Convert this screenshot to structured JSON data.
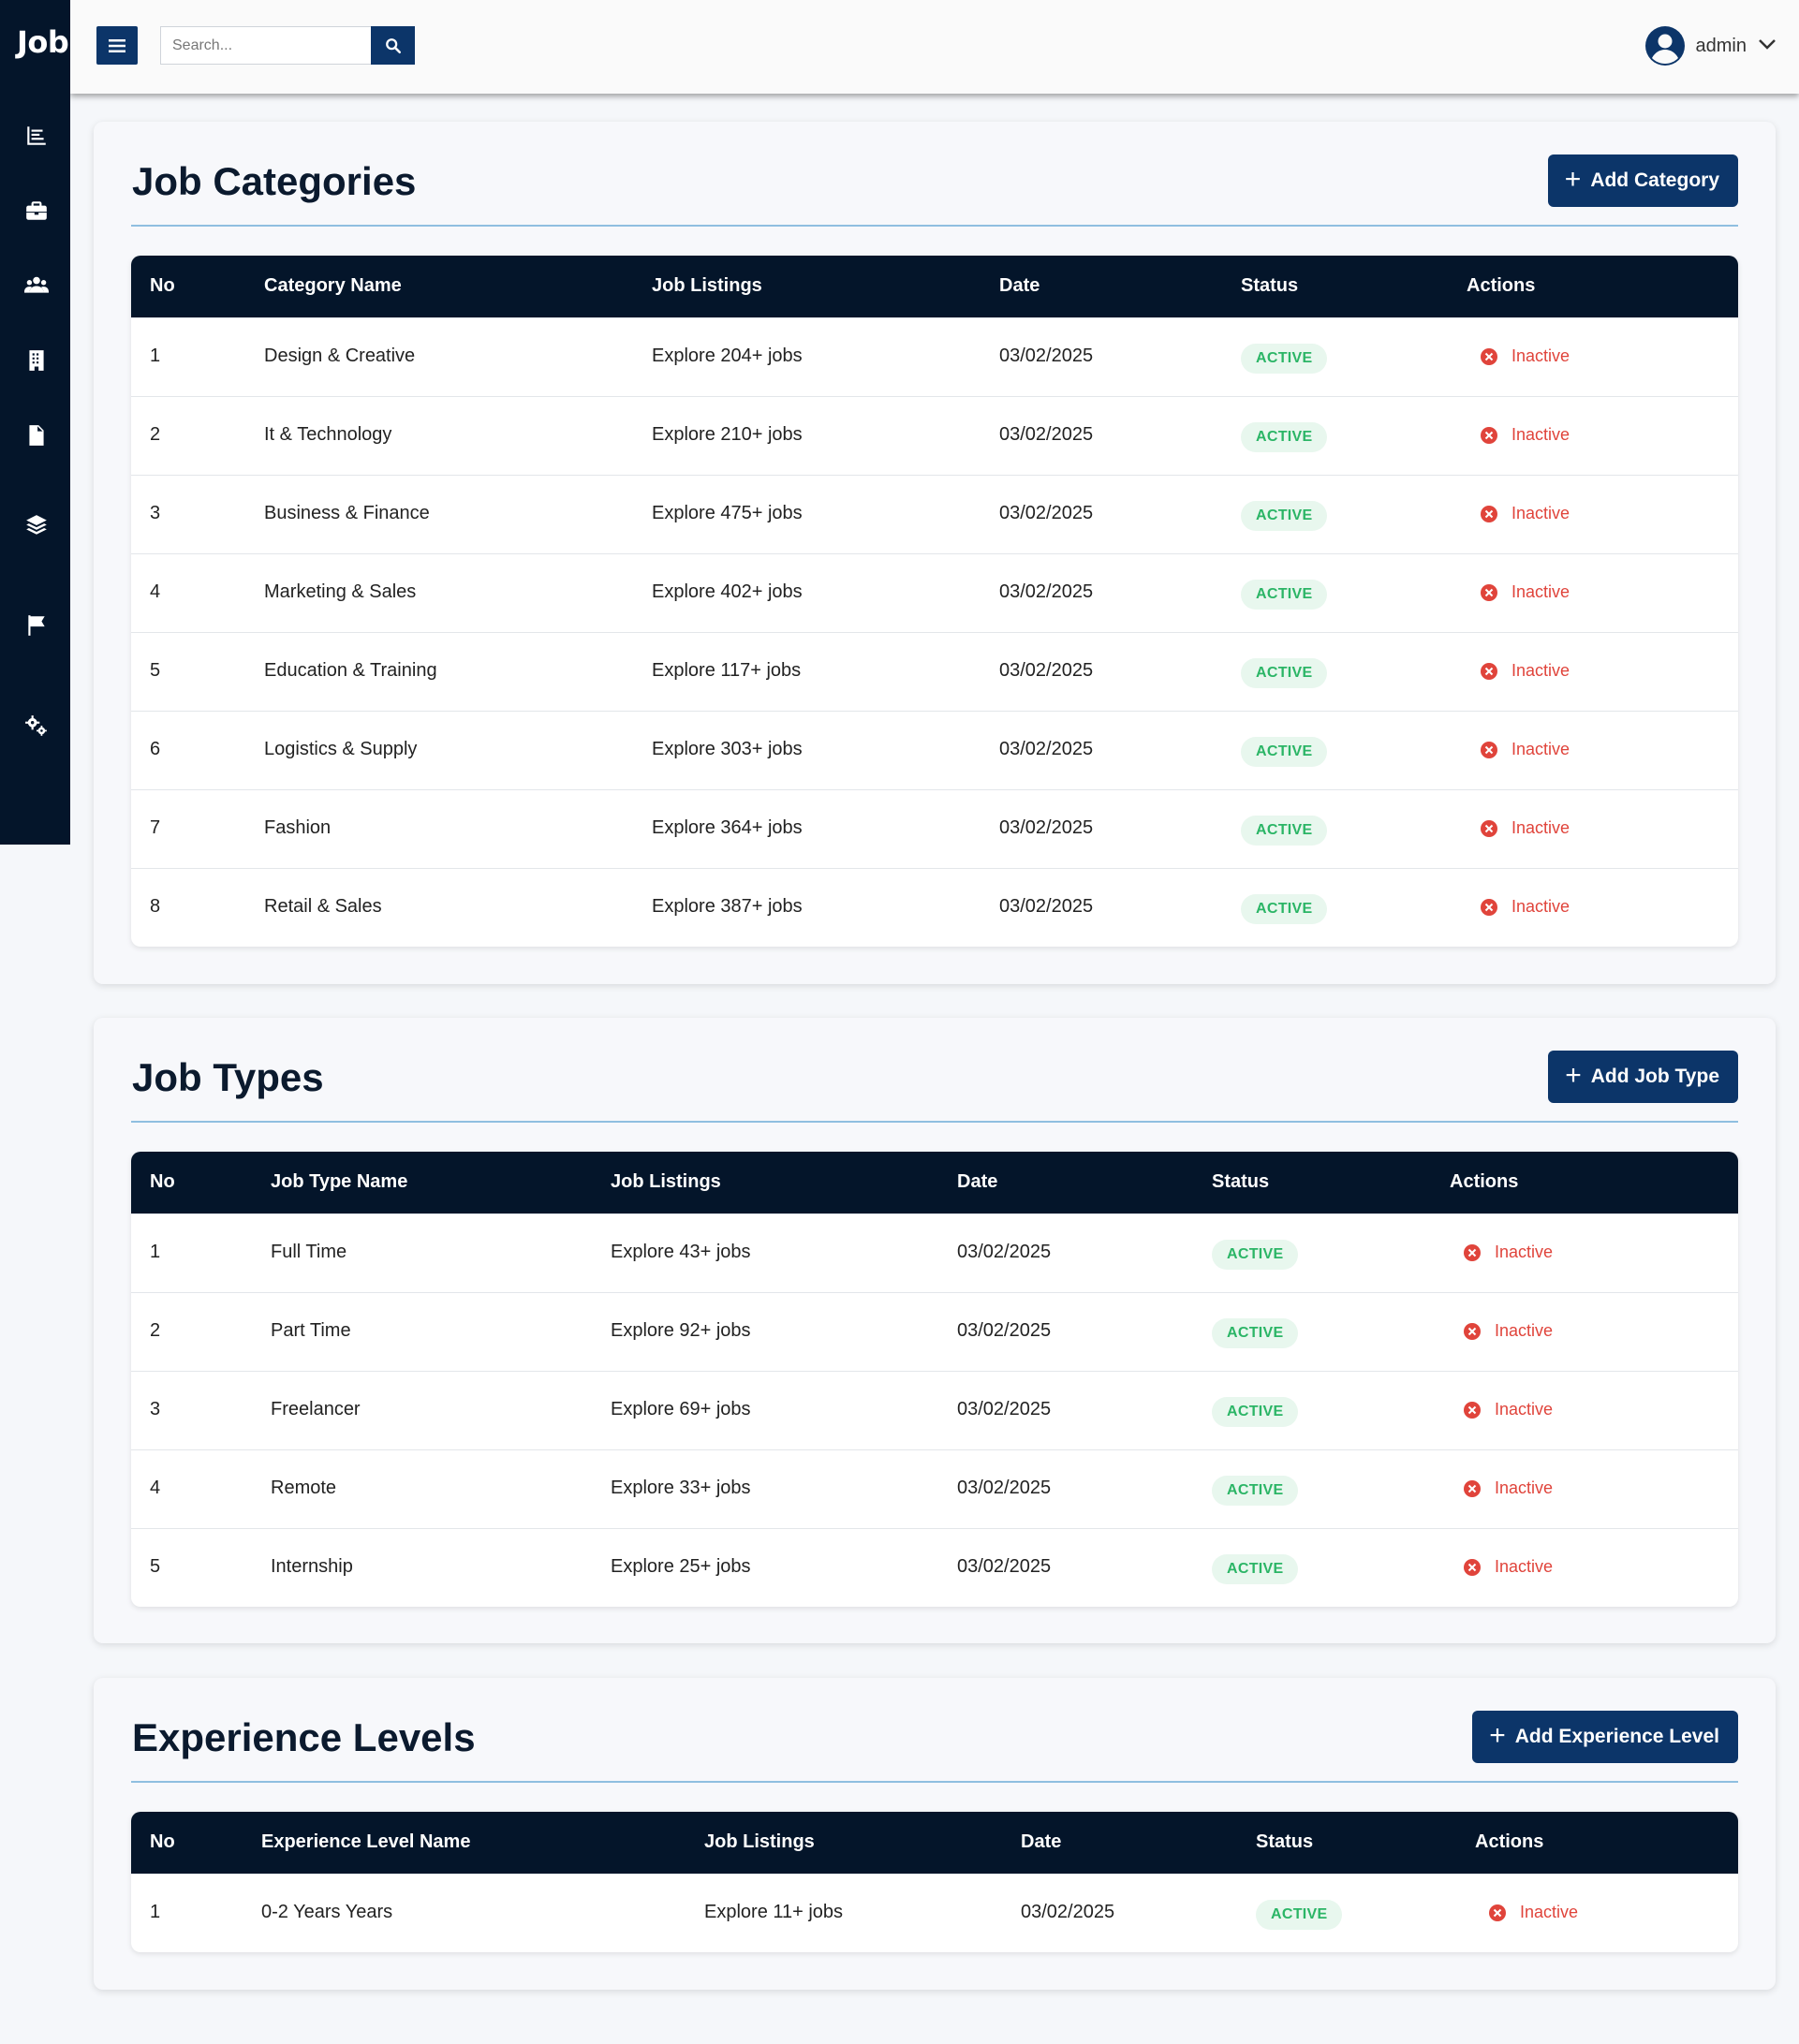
{
  "brand": "Job",
  "search": {
    "placeholder": "Search..."
  },
  "user": {
    "name": "admin"
  },
  "colors": {
    "sidebar": "#04152a",
    "primary": "#0c3569",
    "active_green": "#2bb566",
    "inactive_red": "#e0443b"
  },
  "sidebar": {
    "icons": [
      "chart-icon",
      "briefcase-icon",
      "users-icon",
      "building-icon",
      "document-icon",
      "layers-icon",
      "flag-icon",
      "cogs-icon"
    ]
  },
  "categories": {
    "title": "Job Categories",
    "add_label": "Add Category",
    "columns": [
      "No",
      "Category Name",
      "Job Listings",
      "Date",
      "Status",
      "Actions"
    ],
    "rows": [
      {
        "no": "1",
        "name": "Design & Creative",
        "listings": "Explore 204+ jobs",
        "date": "03/02/2025",
        "status": "ACTIVE",
        "action": "Inactive"
      },
      {
        "no": "2",
        "name": "It & Technology",
        "listings": "Explore 210+ jobs",
        "date": "03/02/2025",
        "status": "ACTIVE",
        "action": "Inactive"
      },
      {
        "no": "3",
        "name": "Business & Finance",
        "listings": "Explore 475+ jobs",
        "date": "03/02/2025",
        "status": "ACTIVE",
        "action": "Inactive"
      },
      {
        "no": "4",
        "name": "Marketing & Sales",
        "listings": "Explore 402+ jobs",
        "date": "03/02/2025",
        "status": "ACTIVE",
        "action": "Inactive"
      },
      {
        "no": "5",
        "name": "Education & Training",
        "listings": "Explore 117+ jobs",
        "date": "03/02/2025",
        "status": "ACTIVE",
        "action": "Inactive"
      },
      {
        "no": "6",
        "name": "Logistics & Supply",
        "listings": "Explore 303+ jobs",
        "date": "03/02/2025",
        "status": "ACTIVE",
        "action": "Inactive"
      },
      {
        "no": "7",
        "name": "Fashion",
        "listings": "Explore 364+ jobs",
        "date": "03/02/2025",
        "status": "ACTIVE",
        "action": "Inactive"
      },
      {
        "no": "8",
        "name": "Retail & Sales",
        "listings": "Explore 387+ jobs",
        "date": "03/02/2025",
        "status": "ACTIVE",
        "action": "Inactive"
      }
    ]
  },
  "types": {
    "title": "Job Types",
    "add_label": "Add Job Type",
    "columns": [
      "No",
      "Job Type Name",
      "Job Listings",
      "Date",
      "Status",
      "Actions"
    ],
    "rows": [
      {
        "no": "1",
        "name": "Full Time",
        "listings": "Explore 43+ jobs",
        "date": "03/02/2025",
        "status": "ACTIVE",
        "action": "Inactive"
      },
      {
        "no": "2",
        "name": "Part Time",
        "listings": "Explore 92+ jobs",
        "date": "03/02/2025",
        "status": "ACTIVE",
        "action": "Inactive"
      },
      {
        "no": "3",
        "name": "Freelancer",
        "listings": "Explore 69+ jobs",
        "date": "03/02/2025",
        "status": "ACTIVE",
        "action": "Inactive"
      },
      {
        "no": "4",
        "name": "Remote",
        "listings": "Explore 33+ jobs",
        "date": "03/02/2025",
        "status": "ACTIVE",
        "action": "Inactive"
      },
      {
        "no": "5",
        "name": "Internship",
        "listings": "Explore 25+ jobs",
        "date": "03/02/2025",
        "status": "ACTIVE",
        "action": "Inactive"
      }
    ]
  },
  "levels": {
    "title": "Experience Levels",
    "add_label": "Add Experience Level",
    "columns": [
      "No",
      "Experience Level Name",
      "Job Listings",
      "Date",
      "Status",
      "Actions"
    ],
    "rows": [
      {
        "no": "1",
        "name": "0-2 Years Years",
        "listings": "Explore 11+ jobs",
        "date": "03/02/2025",
        "status": "ACTIVE",
        "action": "Inactive"
      }
    ]
  }
}
